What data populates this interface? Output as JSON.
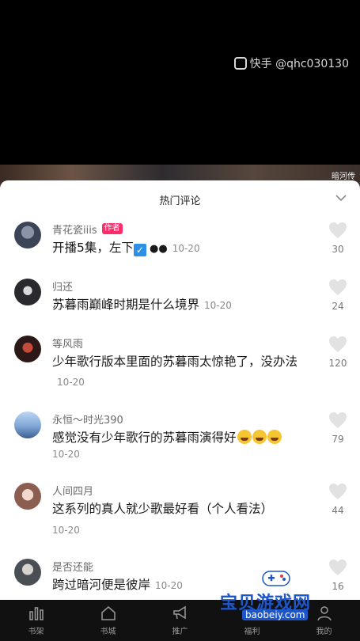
{
  "watermark": {
    "text": "快手 @qhc030130"
  },
  "video": {
    "caption": "暗河传"
  },
  "sheet": {
    "title": "热门评论"
  },
  "comments": [
    {
      "user": "青花瓷iiis",
      "badge": "作者",
      "text": "开播5集，左下",
      "emoji": "✓👀",
      "date": "10-20",
      "likes": "30",
      "avatar_color": "#3c4457"
    },
    {
      "user": "归还",
      "text": "苏暮雨巅峰时期是什么境界",
      "date": "10-20",
      "likes": "24",
      "avatar_color": "#2a2a2e"
    },
    {
      "user": "等风雨",
      "text": "少年歌行版本里面的苏暮雨太惊艳了，没办法",
      "date": "10-20",
      "likes": "120",
      "avatar_color": "#5a2b2b"
    },
    {
      "user": "永恒～时光390",
      "text": "感觉没有少年歌行的苏暮雨演得好",
      "date": "10-20",
      "likes": "79",
      "avatar_color": "#7fa6d6"
    },
    {
      "user": "人间四月",
      "text": "这系列的真人就少歌最好看（个人看法）",
      "date": "10-20",
      "likes": "44",
      "avatar_color": "#c9a59a"
    },
    {
      "user": "是否还能",
      "text": "跨过暗河便是彼岸",
      "date": "10-20",
      "likes": "16",
      "avatar_color": "#4a4f55"
    }
  ],
  "tabbar": {
    "items": [
      {
        "label": "书架",
        "icon": "bars-icon"
      },
      {
        "label": "书城",
        "icon": "home-icon"
      },
      {
        "label": "推广",
        "icon": "megaphone-icon"
      },
      {
        "label": "福利",
        "icon": "gift-icon"
      },
      {
        "label": "我的",
        "icon": "person-icon"
      }
    ]
  },
  "site_watermark": {
    "name": "宝贝游戏网",
    "url": "baobeiy.com"
  },
  "colors": {
    "author_badge": "#ff2c6b",
    "site_blue": "#1d56c9"
  }
}
